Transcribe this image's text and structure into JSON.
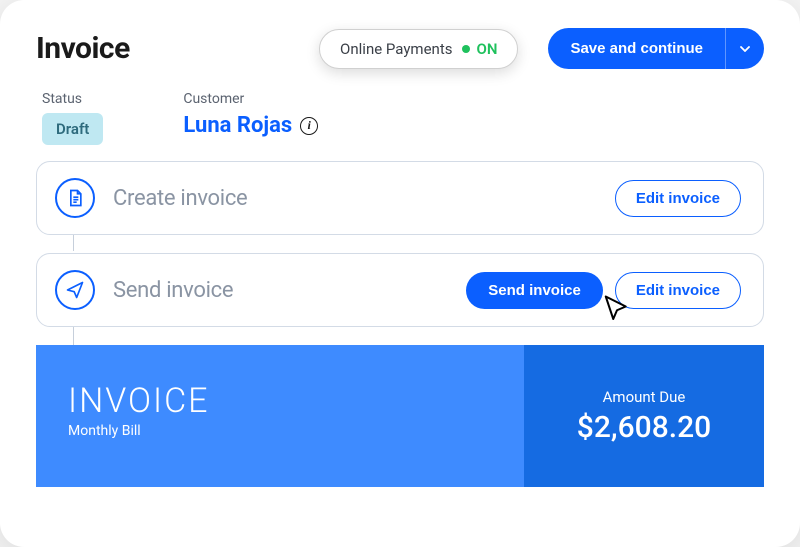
{
  "header": {
    "title": "Invoice",
    "online_payments_label": "Online Payments",
    "online_payments_state": "ON",
    "save_label": "Save and continue"
  },
  "meta": {
    "status_label": "Status",
    "status_value": "Draft",
    "customer_label": "Customer",
    "customer_name": "Luna Rojas"
  },
  "steps": {
    "create": {
      "title": "Create invoice",
      "edit_label": "Edit invoice"
    },
    "send": {
      "title": "Send invoice",
      "send_label": "Send invoice",
      "edit_label": "Edit invoice"
    }
  },
  "preview": {
    "title": "INVOICE",
    "subtitle": "Monthly Bill",
    "amount_due_label": "Amount Due",
    "amount_due_value": "$2,608.20"
  }
}
